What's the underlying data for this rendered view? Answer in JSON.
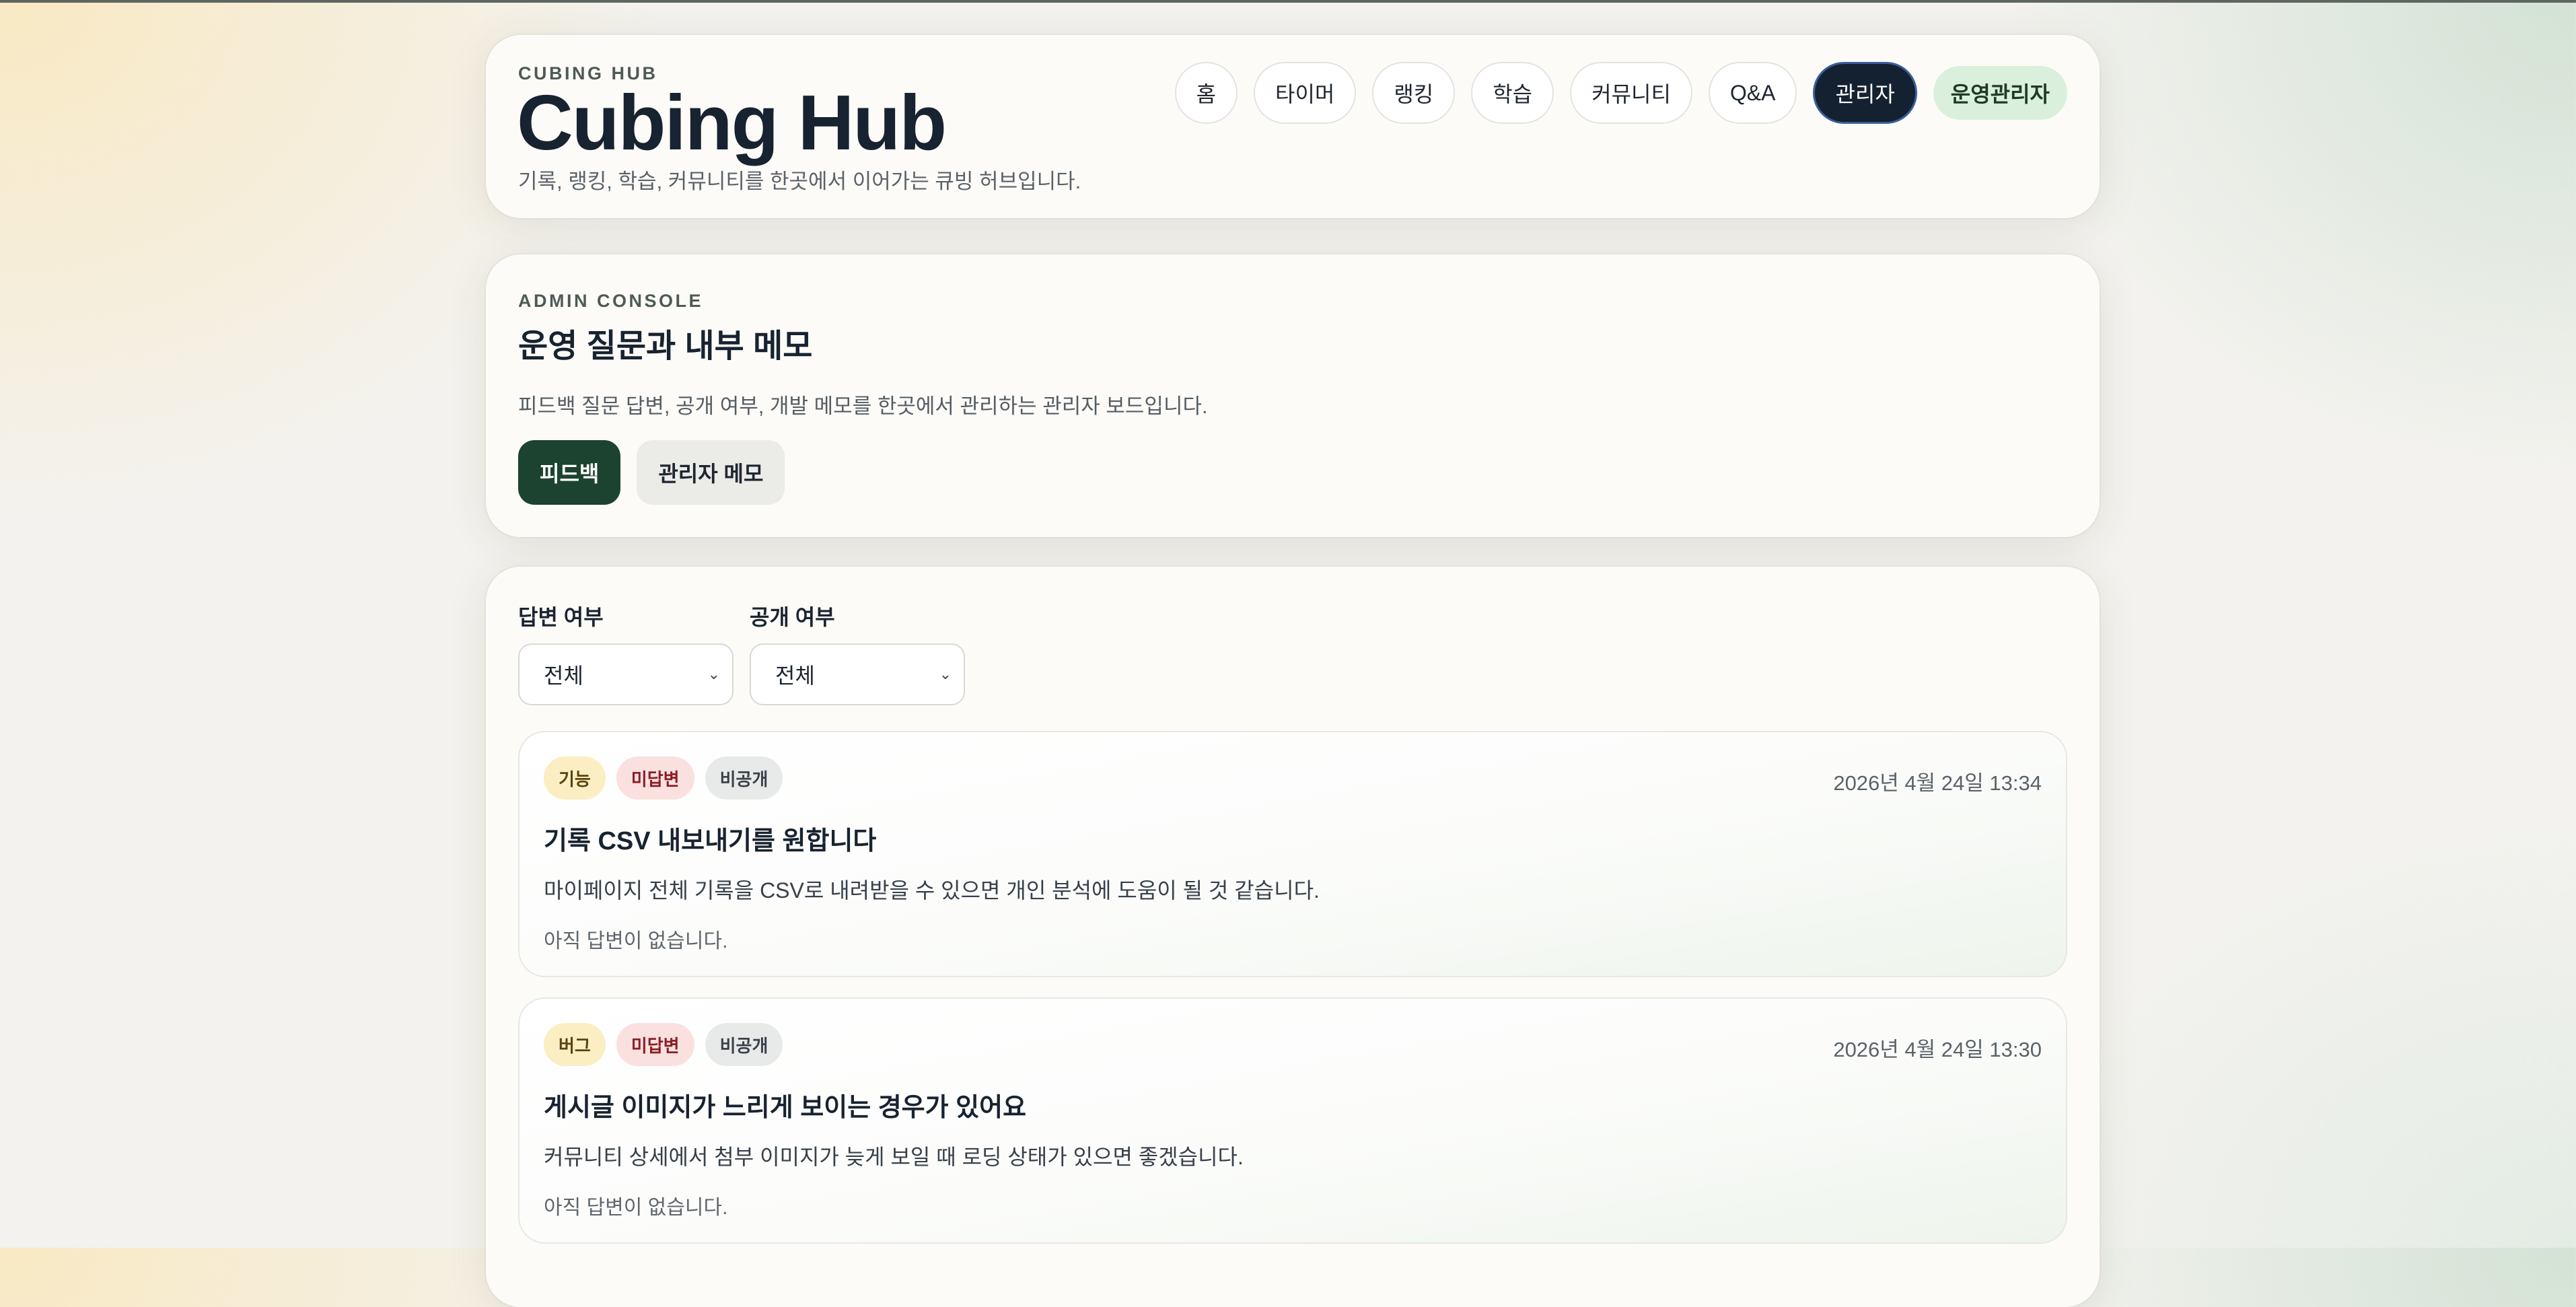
{
  "header": {
    "kicker": "CUBING HUB",
    "title": "Cubing Hub",
    "subtitle": "기록, 랭킹, 학습, 커뮤니티를 한곳에서 이어가는 큐빙 허브입니다.",
    "nav": [
      {
        "label": "홈"
      },
      {
        "label": "타이머"
      },
      {
        "label": "랭킹"
      },
      {
        "label": "학습"
      },
      {
        "label": "커뮤니티"
      },
      {
        "label": "Q&A"
      },
      {
        "label": "관리자",
        "active": true
      },
      {
        "label": "운영관리자"
      }
    ]
  },
  "admin": {
    "kicker": "ADMIN CONSOLE",
    "title": "운영 질문과 내부 메모",
    "description": "피드백 질문 답변, 공개 여부, 개발 메모를 한곳에서 관리하는 관리자 보드입니다.",
    "tabs": [
      {
        "label": "피드백",
        "active": true
      },
      {
        "label": "관리자 메모",
        "active": false
      }
    ]
  },
  "filters": {
    "answer": {
      "label": "답변 여부",
      "value": "전체"
    },
    "visibility": {
      "label": "공개 여부",
      "value": "전체"
    }
  },
  "feedback": [
    {
      "type": "기능",
      "status": "미답변",
      "visibility": "비공개",
      "date": "2026년 4월 24일 13:34",
      "title": "기록 CSV 내보내기를 원합니다",
      "body": "마이페이지 전체 기록을 CSV로 내려받을 수 있으면 개인 분석에 도움이 될 것 같습니다.",
      "answer": "아직 답변이 없습니다."
    },
    {
      "type": "버그",
      "status": "미답변",
      "visibility": "비공개",
      "date": "2026년 4월 24일 13:30",
      "title": "게시글 이미지가 느리게 보이는 경우가 있어요",
      "body": "커뮤니티 상세에서 첨부 이미지가 늦게 보일 때 로딩 상태가 있으면 좋겠습니다.",
      "answer": "아직 답변이 없습니다."
    }
  ],
  "icons": {
    "select_chevron": "chevron-down-icon"
  }
}
